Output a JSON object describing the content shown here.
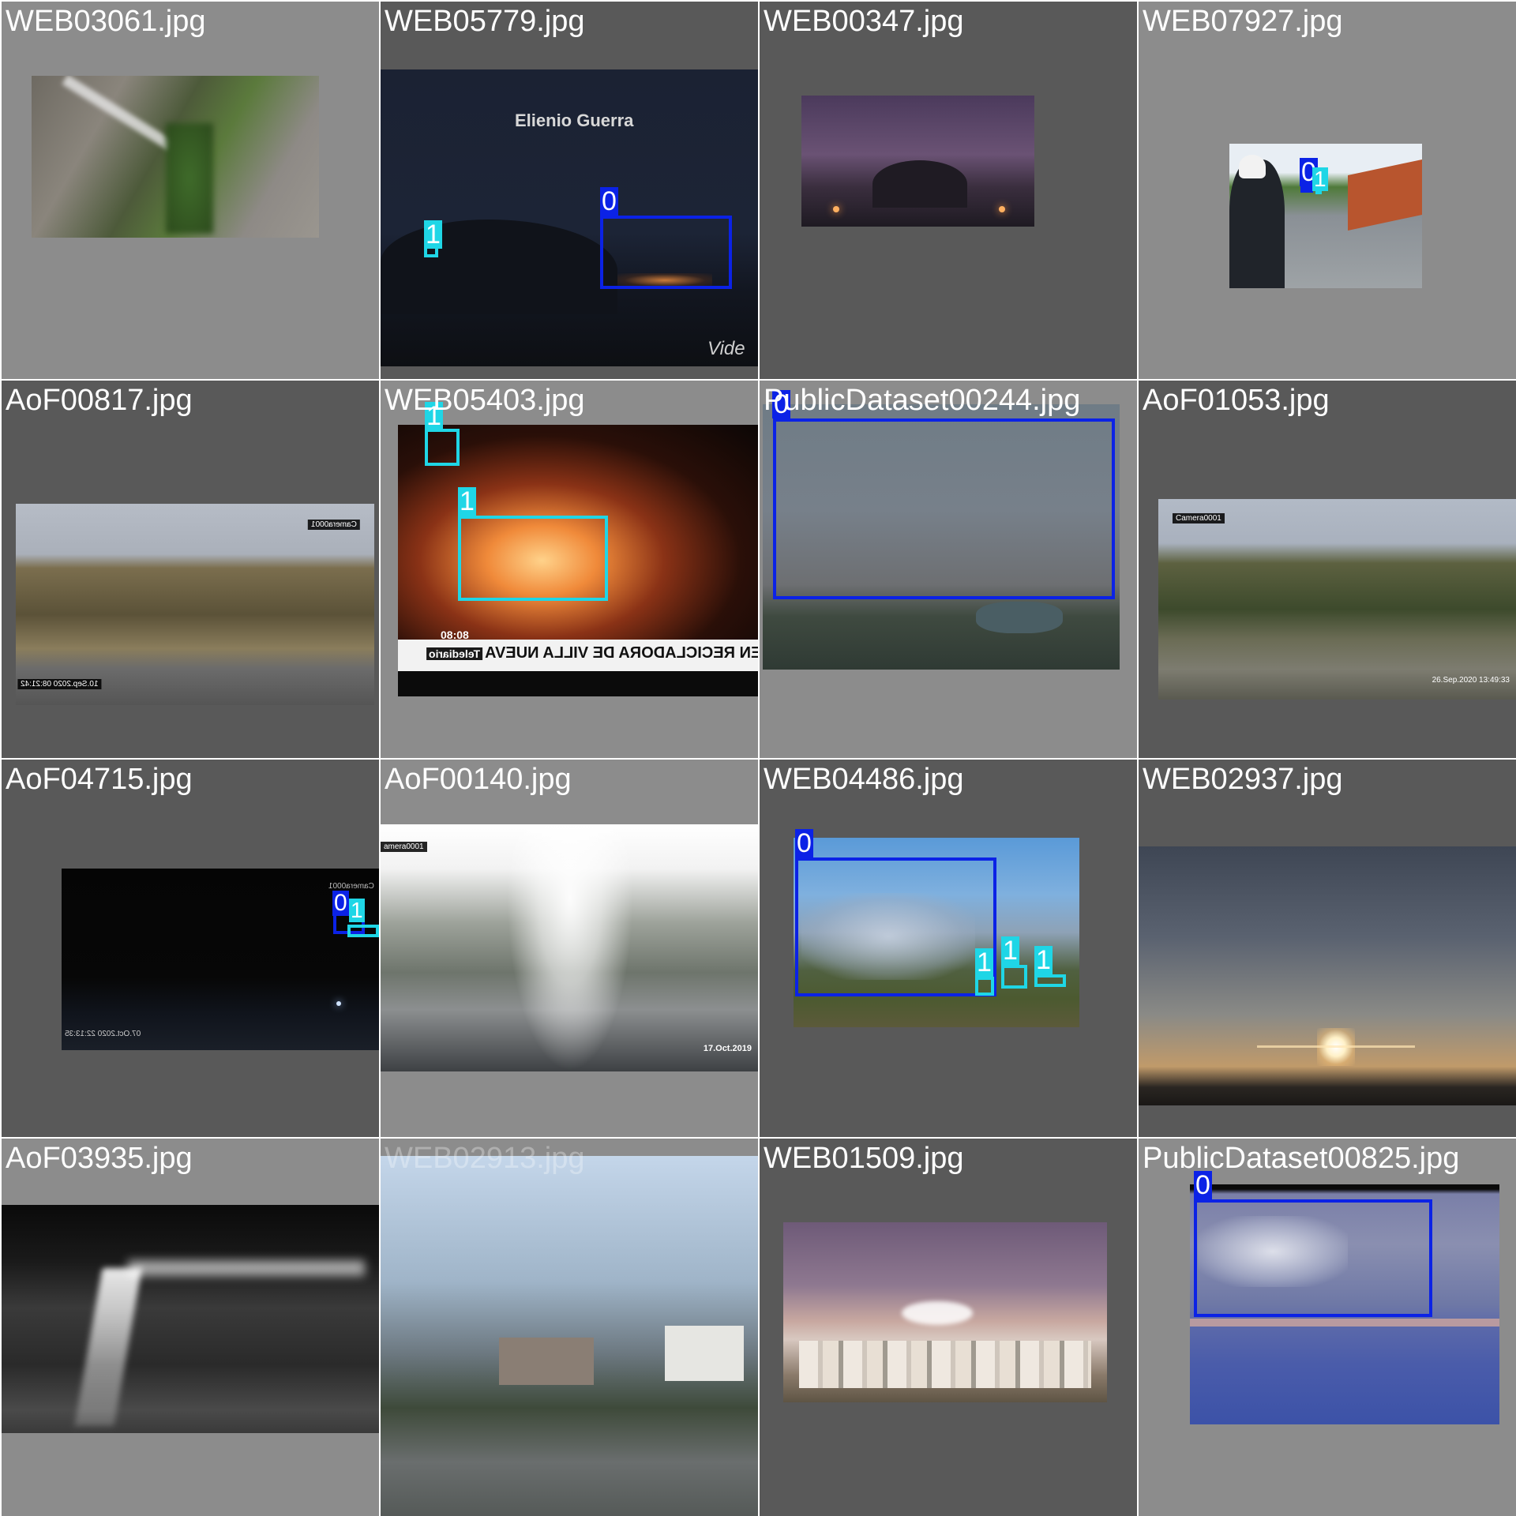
{
  "tiles": [
    {
      "filename": "WEB03061.jpg",
      "boxes": []
    },
    {
      "filename": "WEB05779.jpg",
      "boxes": [
        {
          "class": "0"
        },
        {
          "class": "1"
        }
      ],
      "caption": "Elienio Guerra",
      "watermark": "Vide"
    },
    {
      "filename": "WEB00347.jpg",
      "boxes": []
    },
    {
      "filename": "WEB07927.jpg",
      "boxes": [
        {
          "class": "0"
        },
        {
          "class": "1"
        }
      ]
    },
    {
      "filename": "AoF00817.jpg",
      "boxes": [],
      "camera": "Camera0001",
      "timestamp": "10.Sep.2020  08:21:42"
    },
    {
      "filename": "WEB05403.jpg",
      "boxes": [
        {
          "class": "1"
        },
        {
          "class": "1"
        }
      ],
      "ticker": "INCENDIO EN RECICLADORA DE VILLA NUEVA",
      "ticker_time": "08:08",
      "ticker_brand": "Telediario"
    },
    {
      "filename": "PublicDataset00244.jpg",
      "boxes": [
        {
          "class": "0"
        }
      ]
    },
    {
      "filename": "AoF01053.jpg",
      "boxes": [],
      "camera": "Camera0001",
      "timestamp": "26.Sep.2020  13:49:33"
    },
    {
      "filename": "AoF04715.jpg",
      "boxes": [
        {
          "class": "0"
        },
        {
          "class": "1"
        }
      ],
      "camera": "Camera0001",
      "timestamp": "07.Oct.2020  22:13:35"
    },
    {
      "filename": "AoF00140.jpg",
      "boxes": [],
      "camera": "amera0001",
      "timestamp": "17.Oct.2019"
    },
    {
      "filename": "WEB04486.jpg",
      "boxes": [
        {
          "class": "0"
        },
        {
          "class": "1"
        },
        {
          "class": "1"
        },
        {
          "class": "1"
        }
      ]
    },
    {
      "filename": "WEB02937.jpg",
      "boxes": []
    },
    {
      "filename": "AoF03935.jpg",
      "boxes": []
    },
    {
      "filename": "WEB02913.jpg",
      "boxes": []
    },
    {
      "filename": "WEB01509.jpg",
      "boxes": []
    },
    {
      "filename": "PublicDataset00825.jpg",
      "boxes": [
        {
          "class": "0"
        }
      ]
    }
  ],
  "colors": {
    "class_0": "#0b22e6",
    "class_1": "#1fd6e6"
  }
}
